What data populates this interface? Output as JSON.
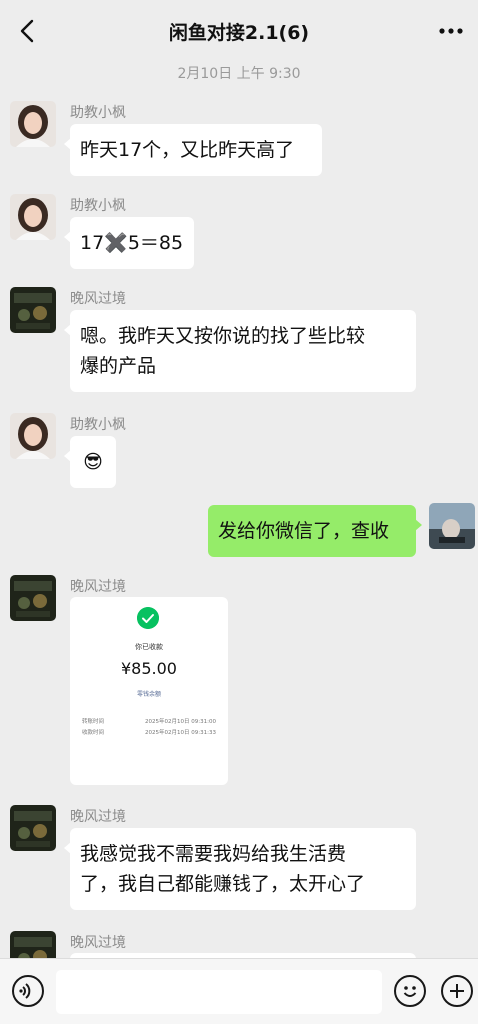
{
  "header": {
    "title": "闲鱼对接2.1(6)"
  },
  "timestamp": "2月10日 上午 9:30",
  "messages": [
    {
      "sender": "助教小枫",
      "text": "昨天17个，又比昨天高了"
    },
    {
      "sender": "助教小枫",
      "text": "17✖️5＝85"
    },
    {
      "sender": "晚风过境",
      "line1": "嗯。我昨天又按你说的找了些比较",
      "line2": "爆的产品"
    },
    {
      "sender": "助教小枫",
      "text": "😎"
    },
    {
      "text": "发给你微信了，查收"
    },
    {
      "sender": "晚风过境",
      "payment": {
        "caption": "你已收款",
        "amount": "¥85.00",
        "link": "零钱余额",
        "rows": [
          {
            "label": "转账时间",
            "value": "2025年02月10日 09:31:00"
          },
          {
            "label": "收款时间",
            "value": "2025年02月10日 09:31:33"
          }
        ]
      }
    },
    {
      "sender": "晚风过境",
      "line1": "我感觉我不需要我妈给我生活费",
      "line2": "了，我自己都能赚钱了，太开心了"
    },
    {
      "sender": "晚风过境"
    }
  ]
}
